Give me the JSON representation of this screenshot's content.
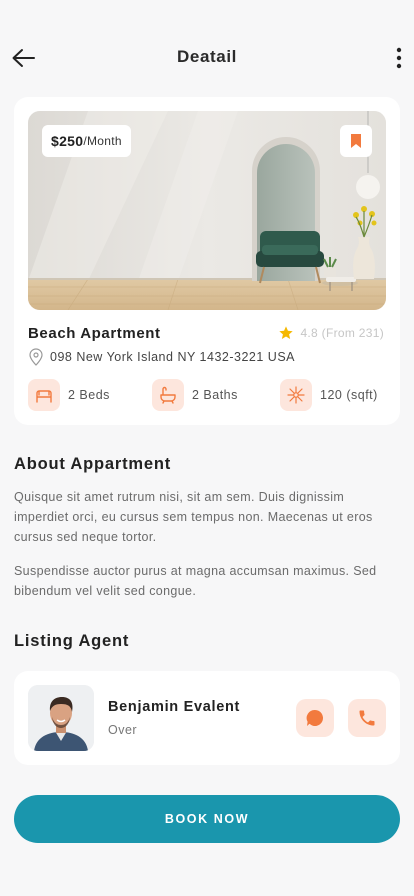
{
  "header": {
    "title": "Deatail",
    "back_icon": "arrow-left-icon",
    "more_icon": "more-vertical-icon"
  },
  "property": {
    "price_amount": "$250",
    "price_period": "/Month",
    "name": "Beach Apartment",
    "rating_text": "4.8 (From 231)",
    "address": "098 New York Island NY 1432-3221 USA",
    "features": [
      {
        "icon": "bed-icon",
        "label": "2 Beds"
      },
      {
        "icon": "bath-icon",
        "label": "2 Baths"
      },
      {
        "icon": "area-icon",
        "label": "120 (sqft)"
      }
    ]
  },
  "about": {
    "title": "About Appartment",
    "paragraphs": [
      "Quisque sit amet rutrum nisi, sit am sem. Duis dignissim imperdiet orci, eu cursus sem tempus non. Maecenas ut eros cursus sed neque tortor.",
      "Suspendisse auctor purus at magna accumsan maximus. Sed bibendum vel velit sed congue."
    ]
  },
  "agent": {
    "section_title": "Listing Agent",
    "name": "Benjamin Evalent",
    "role": "Over"
  },
  "cta": {
    "label": "BOOK NOW"
  },
  "colors": {
    "accent": "#1a96ad",
    "orange": "#f27a3e",
    "orange_soft": "#fde6dd",
    "star": "#f5b800"
  }
}
